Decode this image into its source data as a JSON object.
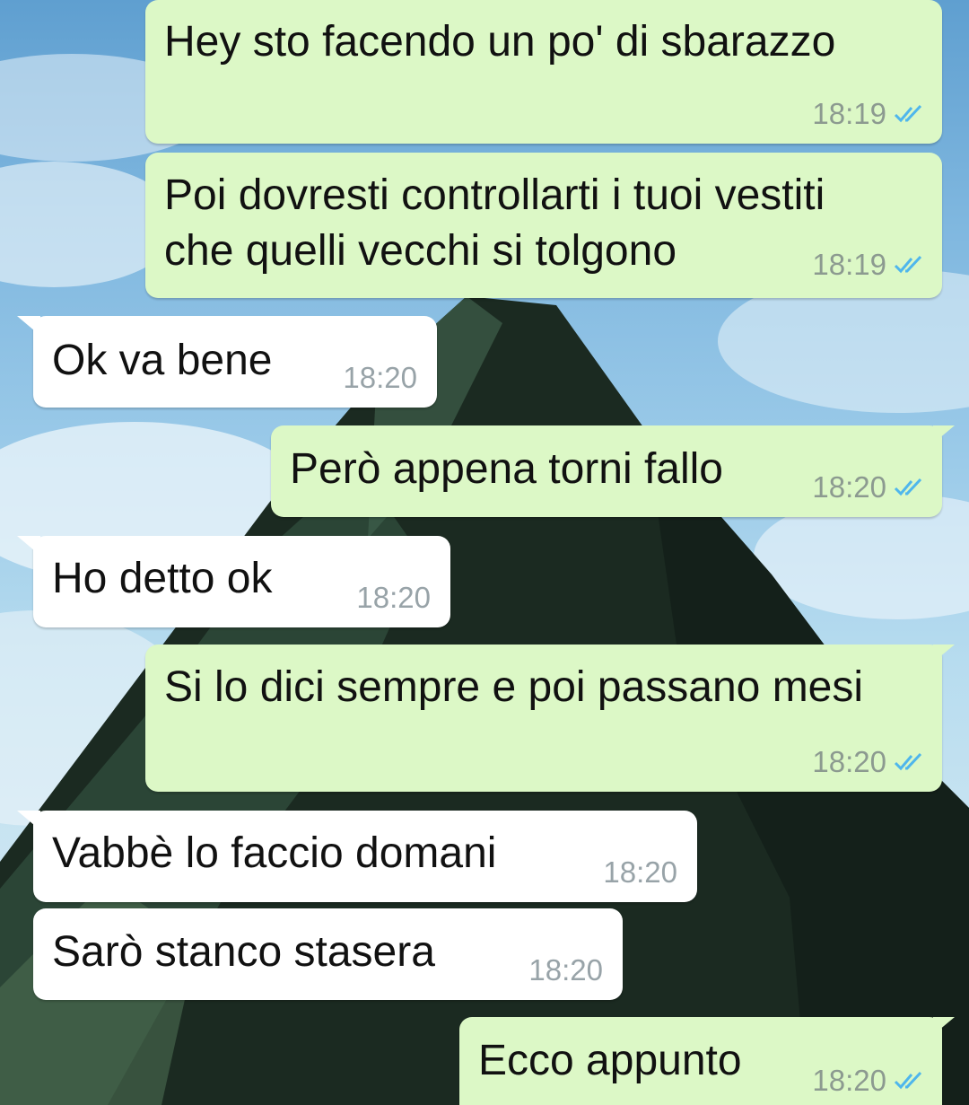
{
  "background": {
    "sky_top": "#5f9fd0",
    "sky_bottom": "#cde6f2",
    "mountain": "#1b2a21"
  },
  "colors": {
    "outgoing_bubble": "#dcf8c6",
    "incoming_bubble": "#ffffff",
    "read_ticks": "#4fb6ec",
    "time_text": "#8c9a90"
  },
  "messages": [
    {
      "direction": "outgoing",
      "text": "Hey sto facendo un po' di sbarazzo",
      "time": "18:19",
      "status": "read"
    },
    {
      "direction": "outgoing",
      "text_lines": [
        "Poi dovresti controllarti i tuoi vestiti",
        "che quelli vecchi si tolgono"
      ],
      "time": "18:19",
      "status": "read"
    },
    {
      "direction": "incoming",
      "text": "Ok va bene",
      "time": "18:20"
    },
    {
      "direction": "outgoing",
      "text": "Però appena torni fallo",
      "time": "18:20",
      "status": "read"
    },
    {
      "direction": "incoming",
      "text": "Ho detto ok",
      "time": "18:20"
    },
    {
      "direction": "outgoing",
      "text": "Si lo dici sempre e poi passano mesi",
      "time": "18:20",
      "status": "read"
    },
    {
      "direction": "incoming",
      "text": "Vabbè lo faccio domani",
      "time": "18:20"
    },
    {
      "direction": "incoming",
      "text": "Sarò stanco stasera",
      "time": "18:20"
    },
    {
      "direction": "outgoing",
      "text": "Ecco appunto",
      "time": "18:20",
      "status": "read"
    }
  ]
}
